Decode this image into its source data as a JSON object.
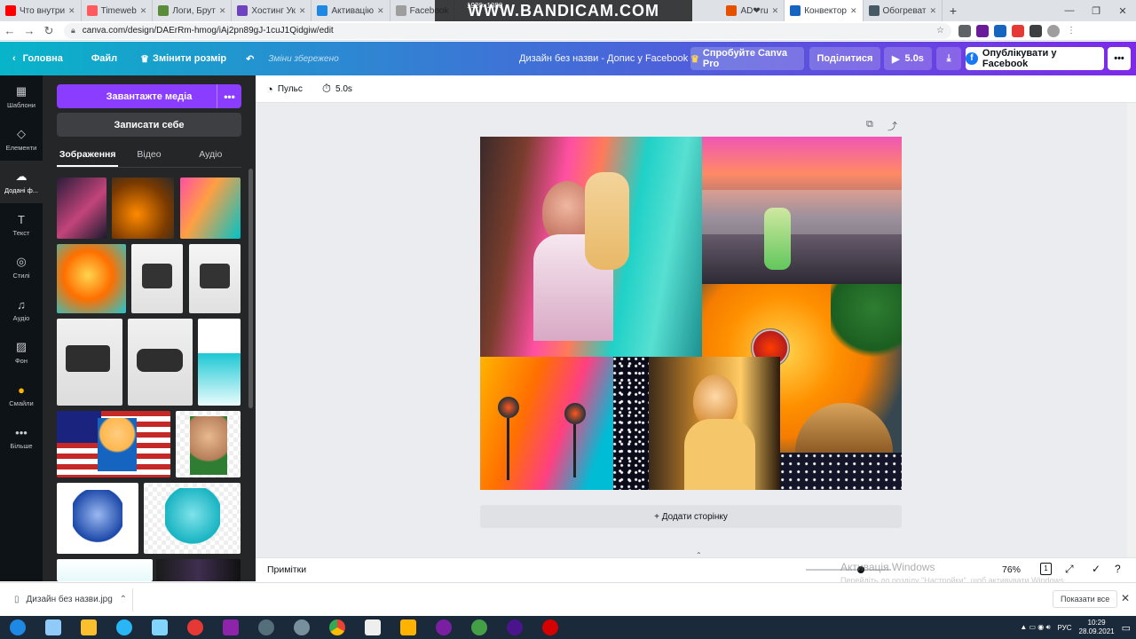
{
  "browser": {
    "tabs": [
      {
        "title": "Что внутри",
        "color": "#ff0000"
      },
      {
        "title": "Timeweb",
        "color": "#ff5a5f"
      },
      {
        "title": "Логи, Брут",
        "color": "#5b8c3a"
      },
      {
        "title": "Хостинг Ук",
        "color": "#6f42c1"
      },
      {
        "title": "Активацію",
        "color": "#1e88e5"
      },
      {
        "title": "Facebook",
        "color": "#9e9e9e"
      },
      {
        "title": "AD❤ru",
        "color": "#e65100"
      },
      {
        "title": "Конвектор",
        "color": "#1565c0"
      },
      {
        "title": "Обогреват",
        "color": "#455a64"
      }
    ],
    "bandicam_text": "WWW.BANDICAM.COM",
    "bandicam_res": "1920×1080",
    "url": "canva.com/design/DAErRm-hmog/iAj2pn89gJ-1cuJ1Qidgiw/edit",
    "window_controls": [
      "—",
      "❐",
      "✕"
    ]
  },
  "canva": {
    "header": {
      "home": "Головна",
      "file": "Файл",
      "resize": "Змінити розмір",
      "saved": "Зміни збережено",
      "title": "Дизайн без назви - Допис у Facebook",
      "try_pro": "Спробуйте Canva Pro",
      "share": "Поділитися",
      "play": "5.0s",
      "publish": "Опублікувати у Facebook"
    },
    "rail": [
      {
        "label": "Шаблони",
        "icon": "▦"
      },
      {
        "label": "Елементи",
        "icon": "◇"
      },
      {
        "label": "Додані ф...",
        "icon": "☁"
      },
      {
        "label": "Текст",
        "icon": "T"
      },
      {
        "label": "Стилі",
        "icon": "◎"
      },
      {
        "label": "Аудіо",
        "icon": "♫"
      },
      {
        "label": "Фон",
        "icon": "▨"
      },
      {
        "label": "Смайли",
        "icon": "●"
      },
      {
        "label": "Більше",
        "icon": "•••"
      }
    ],
    "panel": {
      "upload": "Завантажте медіа",
      "record": "Записати себе",
      "tabs": [
        "Зображення",
        "Відео",
        "Аудіо"
      ]
    },
    "toolbar": {
      "pulse": "Пульс",
      "duration": "5.0s"
    },
    "add_page": "+ Додати сторінку",
    "bottom": {
      "notes": "Примітки",
      "zoom": "76%",
      "page_count": "1"
    },
    "activate": {
      "title": "Активація Windows",
      "sub": "Перейдіть до розділу \"Настройки\", щоб активувати Windows."
    }
  },
  "downloads": {
    "file": "Дизайн без назви.jpg",
    "show_all": "Показати все"
  },
  "taskbar": {
    "lang": "РУС",
    "time": "10:29",
    "date": "28.09.2021"
  }
}
